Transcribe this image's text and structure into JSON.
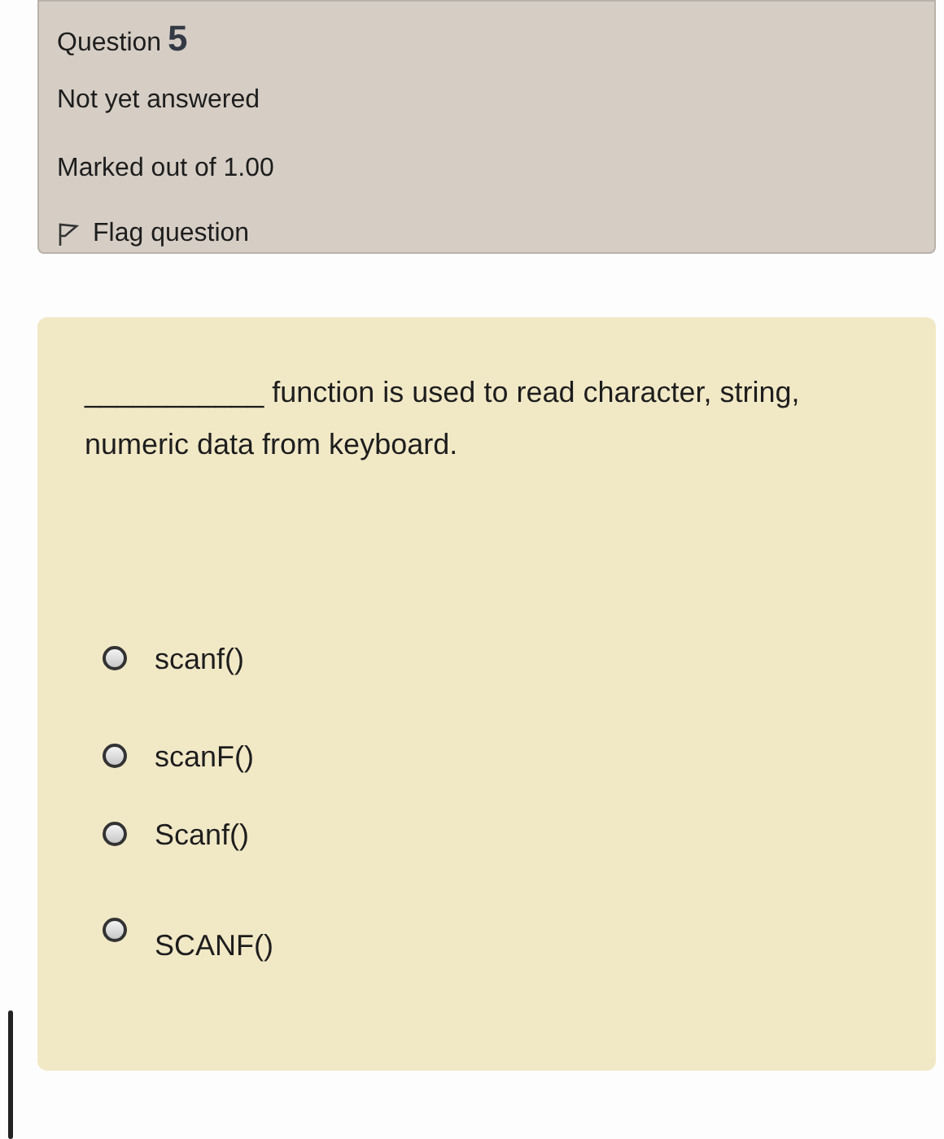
{
  "info": {
    "question_label": "Question",
    "question_number": "5",
    "status": "Not yet answered",
    "marks": "Marked out of 1.00",
    "flag": {
      "label": "Flag question",
      "flagged": false
    }
  },
  "question": {
    "text": "___________ function is used to read character, string, numeric data from keyboard.",
    "options": [
      {
        "label": "scanf()",
        "selected": false
      },
      {
        "label": "scanF()",
        "selected": false
      },
      {
        "label": "Scanf()",
        "selected": false
      },
      {
        "label": "SCANF()",
        "selected": false
      }
    ]
  }
}
